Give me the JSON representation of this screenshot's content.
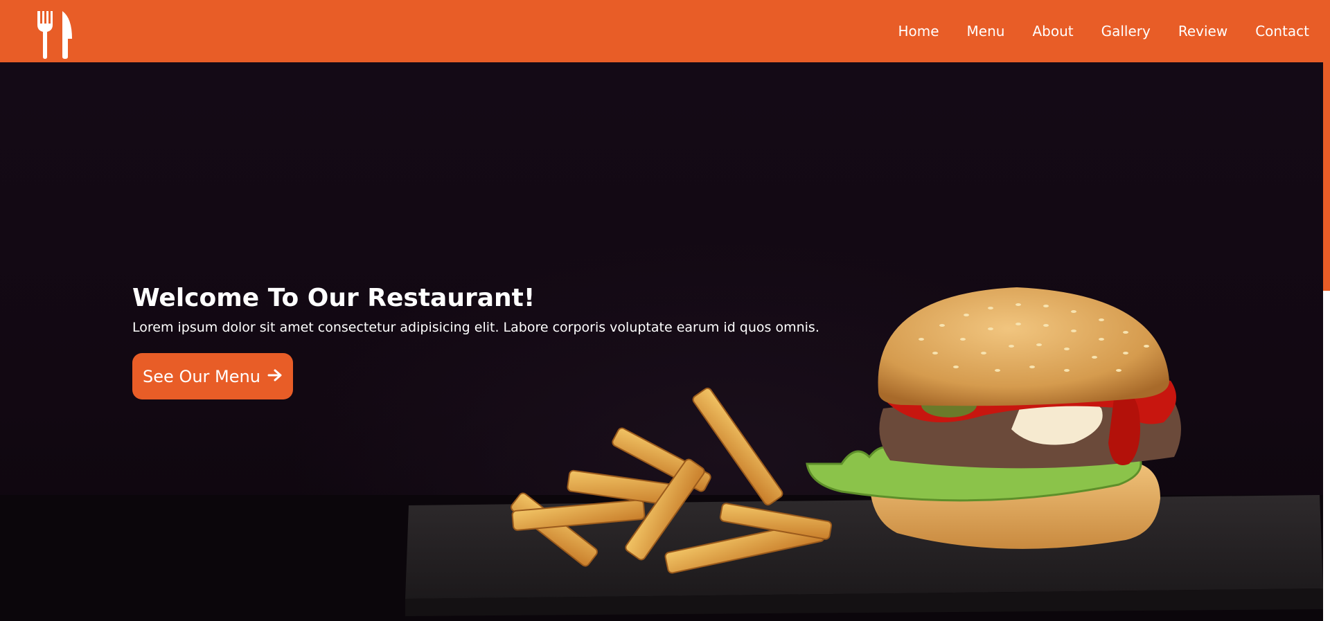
{
  "header": {
    "logo_icon": "fork-knife-icon",
    "nav": [
      {
        "label": "Home"
      },
      {
        "label": "Menu"
      },
      {
        "label": "About"
      },
      {
        "label": "Gallery"
      },
      {
        "label": "Review"
      },
      {
        "label": "Contact"
      }
    ]
  },
  "hero": {
    "title": "Welcome To Our Restaurant!",
    "text": "Lorem ipsum dolor sit amet consectetur adipisicing elit. Labore corporis voluptate earum id quos omnis.",
    "cta_label": "See Our Menu",
    "cta_icon": "arrow-right-icon",
    "image": "burger-and-fries-image"
  },
  "colors": {
    "accent": "#e85d27",
    "background": "#120812",
    "text": "#ffffff"
  }
}
